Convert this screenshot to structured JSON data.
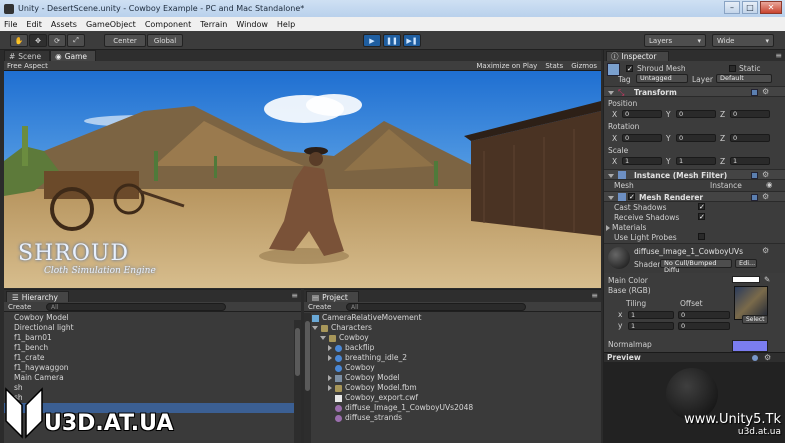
{
  "window": {
    "title": "Unity - DesertScene.unity - Cowboy Example - PC and Mac Standalone*",
    "controls": [
      "–",
      "□",
      "✕"
    ]
  },
  "menu": [
    "File",
    "Edit",
    "Assets",
    "GameObject",
    "Component",
    "Terrain",
    "Window",
    "Help"
  ],
  "toolbar": {
    "pivot": "Center",
    "space": "Global",
    "layers": "Layers",
    "layout": "Wide"
  },
  "scene_panel": {
    "tabs": [
      "Scene",
      "Game"
    ],
    "aspect": "Free Aspect",
    "options": [
      "Maximize on Play",
      "Stats",
      "Gizmos"
    ],
    "logo_title": "SHROUD",
    "logo_subtitle": "Cloth Simulation Engine"
  },
  "hierarchy": {
    "title": "Hierarchy",
    "create": "Create",
    "search_placeholder": "All",
    "items": [
      "Cowboy Model",
      "Directional light",
      "f1_barn01",
      "f1_bench",
      "f1_crate",
      "f1_haywaggon",
      "Main Camera",
      "sh",
      "sh",
      "sh"
    ]
  },
  "project": {
    "title": "Project",
    "create": "Create",
    "search_placeholder": "All",
    "items": [
      {
        "label": "CameraRelativeMovement",
        "icon": "script-icon",
        "indent": 0
      },
      {
        "label": "Characters",
        "icon": "folder-icon",
        "indent": 0
      },
      {
        "label": "Cowboy",
        "icon": "folder-icon",
        "indent": 1
      },
      {
        "label": "backflip",
        "icon": "animation-icon",
        "indent": 2
      },
      {
        "label": "breathing_idle_2",
        "icon": "animation-icon",
        "indent": 2
      },
      {
        "label": "Cowboy",
        "icon": "animation-icon",
        "indent": 2
      },
      {
        "label": "Cowboy Model",
        "icon": "prefab-icon",
        "indent": 2
      },
      {
        "label": "Cowboy Model.fbm",
        "icon": "folder-icon",
        "indent": 2
      },
      {
        "label": "Cowboy_export.cwf",
        "icon": "document-icon",
        "indent": 2
      },
      {
        "label": "diffuse_Image_1_CowboyUVs2048",
        "icon": "texture-icon",
        "indent": 2
      },
      {
        "label": "diffuse_strands",
        "icon": "texture-icon",
        "indent": 2
      }
    ]
  },
  "inspector": {
    "title": "Inspector",
    "object_name": "Shroud Mesh",
    "static_label": "Static",
    "tag_label": "Tag",
    "tag_value": "Untagged",
    "layer_label": "Layer",
    "layer_value": "Default",
    "transform": {
      "title": "Transform",
      "position_label": "Position",
      "rotation_label": "Rotation",
      "scale_label": "Scale",
      "position": [
        "0",
        "0",
        "0"
      ],
      "rotation": [
        "0",
        "0",
        "0"
      ],
      "scale": [
        "1",
        "1",
        "1"
      ]
    },
    "mesh_filter": {
      "title": "Instance (Mesh Filter)",
      "mesh_label": "Mesh",
      "mesh_value": "Instance"
    },
    "mesh_renderer": {
      "title": "Mesh Renderer",
      "cast_shadows": "Cast Shadows",
      "receive_shadows": "Receive Shadows",
      "materials": "Materials",
      "use_light_probes": "Use Light Probes"
    },
    "material": {
      "name": "diffuse_Image_1_CowboyUVs",
      "shader_label": "Shader",
      "shader_value": "No Cull/Bumped Diffu",
      "edit_label": "Edi...",
      "main_color": "Main Color",
      "base_label": "Base (RGB)",
      "tiling_label": "Tiling",
      "offset_label": "Offset",
      "tiling": [
        "1",
        "1"
      ],
      "offset": [
        "0",
        "0"
      ],
      "select_label": "Select",
      "normalmap_label": "Normalmap"
    },
    "preview_label": "Preview"
  },
  "watermarks": {
    "left": "U3D.AT.UA",
    "right_top": "www.Unity5.Tk",
    "right_bottom": "u3d.at.ua"
  },
  "colors": {
    "accent": "#1f5ea0",
    "selection": "#3b5f93",
    "panel": "#3c3c3c"
  }
}
